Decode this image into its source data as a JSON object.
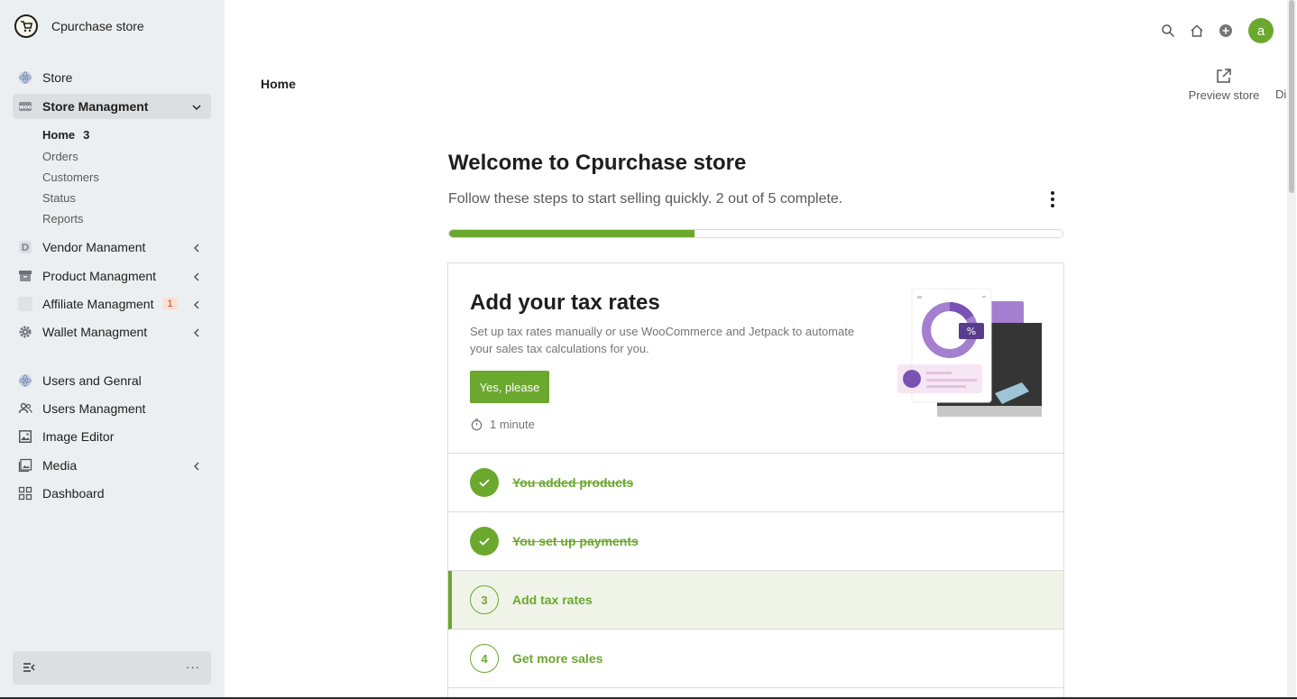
{
  "sidebar": {
    "brand": "Cpurchase store",
    "items": {
      "store": "Store",
      "store_management": "Store Managment",
      "vendor": "Vendor Manament",
      "product": "Product Managment",
      "affiliate": "Affiliate Managment",
      "affiliate_badge": "1",
      "wallet": "Wallet Managment",
      "users_general": "Users and Genral",
      "users_management": "Users Managment",
      "image_editor": "Image Editor",
      "media": "Media",
      "dashboard": "Dashboard"
    },
    "submenu": {
      "home": "Home",
      "home_count": "3",
      "orders": "Orders",
      "customers": "Customers",
      "status": "Status",
      "reports": "Reports"
    },
    "footer_more": "···"
  },
  "header": {
    "page_title": "Home",
    "preview_label": "Preview store",
    "cut_label": "Di",
    "avatar_initial": "a"
  },
  "setup": {
    "title": "Welcome to Cpurchase store",
    "subtitle": "Follow these steps to start selling quickly. 2 out of 5 complete.",
    "progress_fraction": 0.4
  },
  "hero": {
    "title": "Add your tax rates",
    "description": "Set up tax rates manually or use WooCommerce and Jetpack to automate your sales tax calculations for you.",
    "button": "Yes, please",
    "time": "1 minute",
    "illustration_percent": "%"
  },
  "tasks": [
    {
      "label": "You added products",
      "status": "done"
    },
    {
      "label": "You set up payments",
      "status": "done"
    },
    {
      "number": "3",
      "label": "Add tax rates",
      "status": "active"
    },
    {
      "number": "4",
      "label": "Get more sales",
      "status": "todo"
    }
  ],
  "colors": {
    "accent": "#6ba82e",
    "sidebar_bg": "#eceff1",
    "active_row_bg": "#f0f4e8"
  }
}
